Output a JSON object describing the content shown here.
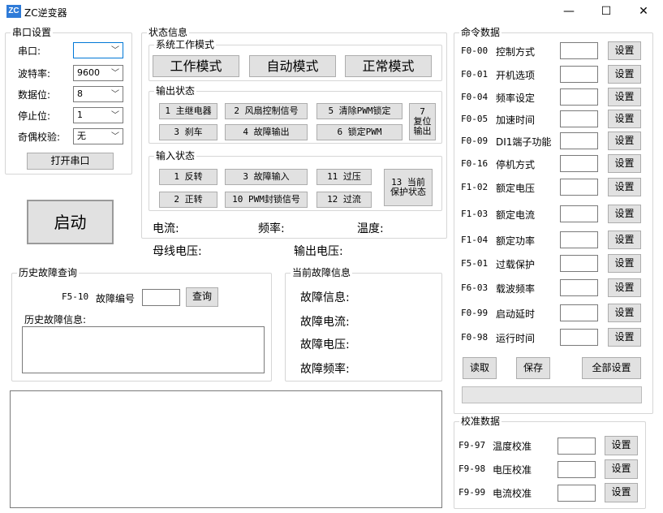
{
  "window": {
    "icon": "ZC",
    "title": "ZC逆变器",
    "minimize": "—",
    "maximize": "☐",
    "close": "✕"
  },
  "serial": {
    "title": "串口设置",
    "port_label": "串口:",
    "port_value": "",
    "baud_label": "波特率:",
    "baud_value": "9600",
    "databits_label": "数据位:",
    "databits_value": "8",
    "stopbits_label": "停止位:",
    "stopbits_value": "1",
    "parity_label": "奇偶校验:",
    "parity_value": "无",
    "open_button": "打开串口"
  },
  "start_button": "启动",
  "status": {
    "title": "状态信息",
    "mode_title": "系统工作模式",
    "mode_buttons": [
      "工作模式",
      "自动模式",
      "正常模式"
    ],
    "output_title": "输出状态",
    "output_buttons": [
      "1 主继电器",
      "2 风扇控制信号",
      "5 清除PWM锁定",
      "3 刹车",
      "4 故障输出",
      "6 锁定PWM"
    ],
    "reset_button_line1": "7",
    "reset_button_line2": "复位",
    "reset_button_line3": "输出",
    "input_title": "输入状态",
    "input_buttons": [
      "1 反转",
      "3 故障输入",
      "11 过压",
      "2 正转",
      "10 PWM封锁信号",
      "12 过流"
    ],
    "protect_line1": "13 当前",
    "protect_line2": "保护状态",
    "current_label": "电流:",
    "freq_label": "频率:",
    "temp_label": "温度:",
    "bus_voltage_label": "母线电压:",
    "out_voltage_label": "输出电压:"
  },
  "history": {
    "title": "历史故障查询",
    "code": "F5-10",
    "fault_no_label": "故障编号",
    "query_button": "查询",
    "info_label": "历史故障信息:"
  },
  "current_fault": {
    "title": "当前故障信息",
    "info_label": "故障信息:",
    "current_label": "故障电流:",
    "voltage_label": "故障电压:",
    "freq_label": "故障频率:"
  },
  "commands": {
    "title": "命令数据",
    "set_label": "设置",
    "rows": [
      {
        "code": "F0-00",
        "name": "控制方式"
      },
      {
        "code": "F0-01",
        "name": "开机选项"
      },
      {
        "code": "F0-04",
        "name": "频率设定"
      },
      {
        "code": "F0-05",
        "name": "加速时间"
      },
      {
        "code": "F0-09",
        "name": "DI1端子功能"
      },
      {
        "code": "F0-16",
        "name": "停机方式"
      },
      {
        "code": "F1-02",
        "name": "额定电压"
      },
      {
        "code": "F1-03",
        "name": "额定电流"
      },
      {
        "code": "F1-04",
        "name": "额定功率"
      },
      {
        "code": "F5-01",
        "name": "过载保护"
      },
      {
        "code": "F6-03",
        "name": "载波频率"
      },
      {
        "code": "F0-99",
        "name": "启动延时"
      },
      {
        "code": "F0-98",
        "name": "运行时间"
      }
    ],
    "read_button": "读取",
    "save_button": "保存",
    "set_all_button": "全部设置"
  },
  "calibration": {
    "title": "校准数据",
    "set_label": "设置",
    "rows": [
      {
        "code": "F9-97",
        "name": "温度校准"
      },
      {
        "code": "F9-98",
        "name": "电压校准"
      },
      {
        "code": "F9-99",
        "name": "电流校准"
      }
    ]
  }
}
